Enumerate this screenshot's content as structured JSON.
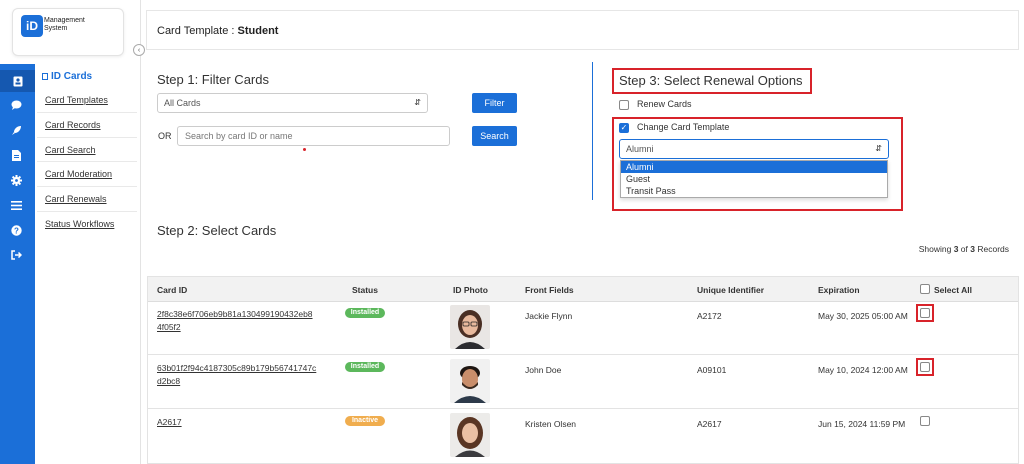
{
  "app": {
    "logo_badge": "iD",
    "logo_line1": "Management",
    "logo_line2": "System"
  },
  "rail_icons": [
    "id-card-icon",
    "chat-icon",
    "rocket-icon",
    "document-icon",
    "gear-icon",
    "list-icon",
    "help-icon",
    "logout-icon"
  ],
  "sidebar": {
    "section": "ID Cards",
    "items": [
      {
        "label": "Card Templates"
      },
      {
        "label": "Card Records"
      },
      {
        "label": "Card Search"
      },
      {
        "label": "Card Moderation"
      },
      {
        "label": "Card Renewals"
      },
      {
        "label": "Status Workflows"
      }
    ]
  },
  "header": {
    "prefix": "Card Template : ",
    "template": "Student"
  },
  "step1": {
    "title": "Step 1: Filter Cards",
    "select_value": "All Cards",
    "filter_label": "Filter",
    "or_label": "OR",
    "search_placeholder": "Search by card ID or name",
    "search_label": "Search"
  },
  "step2": {
    "title": "Step 2: Select Cards"
  },
  "step3": {
    "title": "Step 3: Select Renewal Options",
    "renew_label": "Renew Cards",
    "renew_checked": false,
    "change_label": "Change Card Template",
    "change_checked": true,
    "template_value": "Alumni",
    "template_options": [
      "Alumni",
      "Guest",
      "Transit Pass"
    ]
  },
  "showing": {
    "prefix": "Showing ",
    "shown": "3",
    "of": " of ",
    "total": "3",
    "suffix": " Records"
  },
  "table": {
    "columns": {
      "card_id": "Card ID",
      "status": "Status",
      "photo": "ID Photo",
      "front_fields": "Front Fields",
      "unique_identifier": "Unique Identifier",
      "expiration": "Expiration",
      "select_all": "Select All"
    },
    "rows": [
      {
        "card_id": "2f8c38e6f706eb9b81a130499190432eb84f05f2",
        "status": "Installed",
        "status_color": "#5cb85c",
        "name": "Jackie Flynn",
        "uid": "A2172",
        "expiration": "May 30, 2025 05:00 AM"
      },
      {
        "card_id": "63b01f2f94c4187305c89b179b56741747cd2bc8",
        "status": "Installed",
        "status_color": "#5cb85c",
        "name": "John Doe",
        "uid": "A09101",
        "expiration": "May 10, 2024 12:00 AM"
      },
      {
        "card_id": "A2617",
        "status": "Inactive",
        "status_color": "#f0ad4e",
        "name": "Kristen Olsen",
        "uid": "A2617",
        "expiration": "Jun 15, 2024 11:59 PM"
      }
    ]
  },
  "colors": {
    "primary": "#1b6fd8",
    "highlight": "#d8232a"
  }
}
